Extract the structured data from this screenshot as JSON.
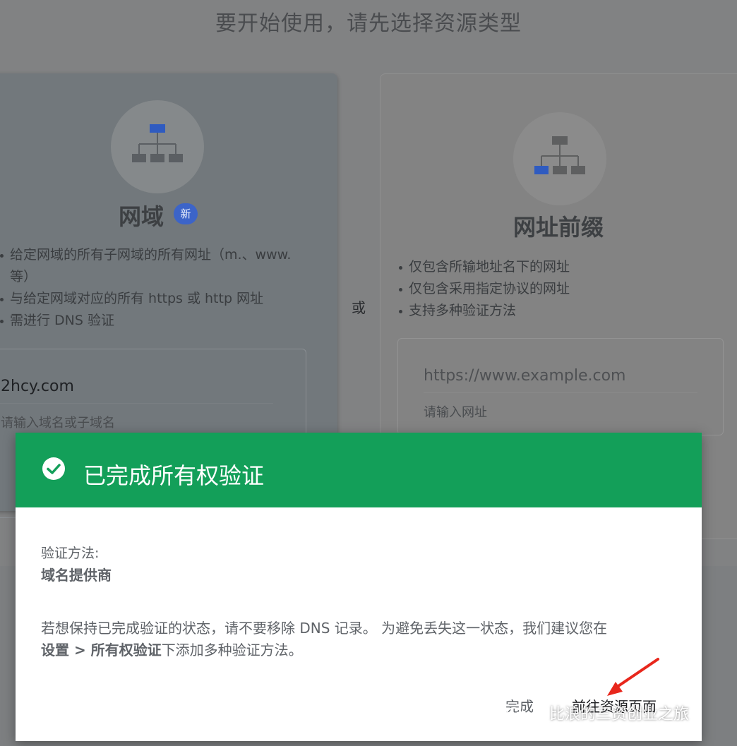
{
  "page": {
    "heading": "要开始使用，请先选择资源类型",
    "or_label": "或"
  },
  "domain_card": {
    "title": "网域",
    "badge": "新",
    "features": [
      "给定网域的所有子网域的所有网址（m.、www.等）",
      "与给定网域对应的所有 https 或 http 网址",
      "需进行 DNS 验证"
    ],
    "input_value": "2hcy.com",
    "input_hint": "请输入域名或子域名",
    "icon": "sitemap-top-highlight-icon"
  },
  "prefix_card": {
    "title": "网址前缀",
    "features": [
      "仅包含所输地址名下的网址",
      "仅包含采用指定协议的网址",
      "支持多种验证方法"
    ],
    "input_placeholder": "https://www.example.com",
    "input_hint": "请输入网址",
    "icon": "sitemap-bottom-highlight-icon"
  },
  "dialog": {
    "title": "已完成所有权验证",
    "method_label": "验证方法:",
    "method_value": "域名提供商",
    "notice_text": "若想保持已完成验证的状态，请不要移除 DNS 记录。 为避免丢失这一状态，我们建议您在",
    "notice_bold": "设置 > 所有权验证",
    "notice_tail": "下添加多种验证方法。",
    "done_button": "完成",
    "go_button": "前往资源页面",
    "header_color": "#139f59"
  },
  "watermark": {
    "text": "比浪的三资创业之旅",
    "icon": "wechat-icon"
  },
  "colors": {
    "accent_blue": "#3c64c8",
    "arrow_red": "#e8271c"
  }
}
